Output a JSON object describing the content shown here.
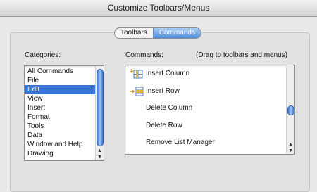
{
  "window": {
    "title": "Customize Toolbars/Menus"
  },
  "tabs": [
    {
      "label": "Toolbars",
      "active": false
    },
    {
      "label": "Commands",
      "active": true
    }
  ],
  "categories": {
    "label": "Categories:",
    "items": [
      "All Commands",
      "File",
      "Edit",
      "View",
      "Insert",
      "Format",
      "Tools",
      "Data",
      "Window and Help",
      "Drawing"
    ],
    "selected_index": 2
  },
  "commands": {
    "label": "Commands:",
    "hint": "(Drag to toolbars and menus)",
    "items": [
      {
        "label": "Insert Column",
        "icon": "insert-column-icon"
      },
      {
        "label": "Insert Row",
        "icon": "insert-row-icon"
      },
      {
        "label": "Delete Column",
        "icon": ""
      },
      {
        "label": "Delete Row",
        "icon": ""
      },
      {
        "label": "Remove List Manager",
        "icon": ""
      }
    ]
  },
  "colors": {
    "selection": "#3875d7",
    "tab_active": "#4f8ee0"
  }
}
